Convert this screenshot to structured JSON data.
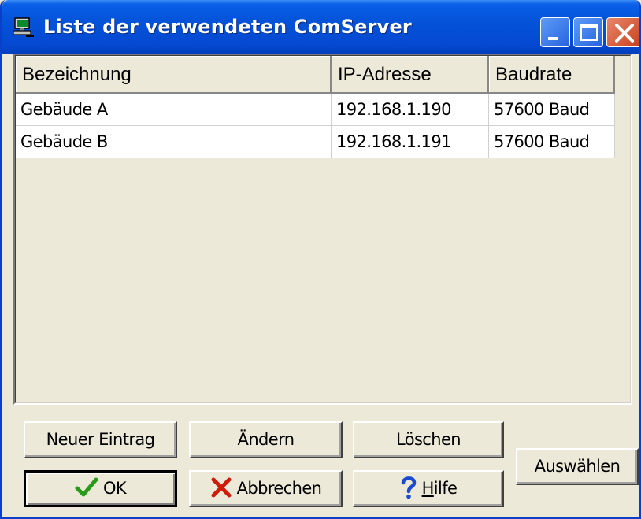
{
  "window": {
    "title": "Liste der verwendeten ComServer",
    "icon": "network-computer-icon",
    "controls": [
      "minimize-icon",
      "maximize-icon",
      "close-icon"
    ]
  },
  "table": {
    "columns": [
      "Bezeichnung",
      "IP-Adresse",
      "Baudrate"
    ],
    "rows": [
      {
        "name": "Gebäude A",
        "ip": "192.168.1.190",
        "baud": "57600 Baud",
        "selected": true
      },
      {
        "name": "Gebäude B",
        "ip": "192.168.1.191",
        "baud": "57600 Baud",
        "selected": false
      }
    ]
  },
  "buttons": {
    "new_entry": "Neuer Eintrag",
    "edit": "Ändern",
    "delete": "Löschen",
    "select": "Auswählen",
    "ok": "OK",
    "cancel": "Abbrechen",
    "help_first": "H",
    "help_rest": "ilfe"
  },
  "icons": {
    "ok": "checkmark-icon",
    "cancel": "x-mark-icon",
    "help": "question-mark-icon"
  },
  "colors": {
    "titlebar": "#0453d8",
    "window_bg": "#ece9d8",
    "close_button": "#c8421f",
    "ok_icon": "#2a9a1a",
    "cancel_icon": "#d01a0a",
    "help_icon": "#1a4ad0"
  }
}
